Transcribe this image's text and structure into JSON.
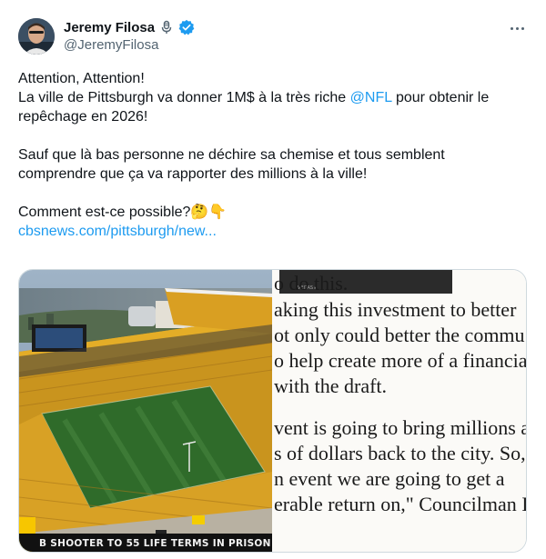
{
  "author": {
    "display_name": "Jeremy Filosa",
    "handle": "@JeremyFilosa"
  },
  "icons": {
    "avatar": "avatar",
    "microphone": "mic-icon",
    "verified": "verified-icon",
    "more": "more-icon"
  },
  "colors": {
    "link": "#1d9bf0",
    "muted": "#536471",
    "verified": "#1d9bf0"
  },
  "tweet": {
    "line1": "Attention, Attention!",
    "line2_a": "La ville de Pittsburgh va donner 1M$ à la très riche ",
    "mention": "@NFL",
    "line2_b": " pour obtenir le",
    "line3": "repêchage en 2026!",
    "line4": "Sauf que là bas personne ne déchire sa chemise et tous semblent",
    "line5": "comprendre que ça va rapporter des millions à la ville!",
    "line6": "Comment est-ce possible?🤔👇",
    "link": "cbsnews.com/pittsburgh/new..."
  },
  "media": {
    "chyron_badge": "H",
    "chyron": "B SHOOTER TO 55 LIFE TERMS IN PRISON",
    "video_bar_text": "VEGAS ▸",
    "article_lines": [
      "o do this.",
      "aking this investment to better",
      "ot only could better the commu",
      "o help create more of a financia",
      "with the draft.",
      "",
      "vent is going to bring millions a",
      "s of dollars back to the city. So,",
      "n event we are going to get a",
      "erable return on,\" Councilman I"
    ]
  }
}
